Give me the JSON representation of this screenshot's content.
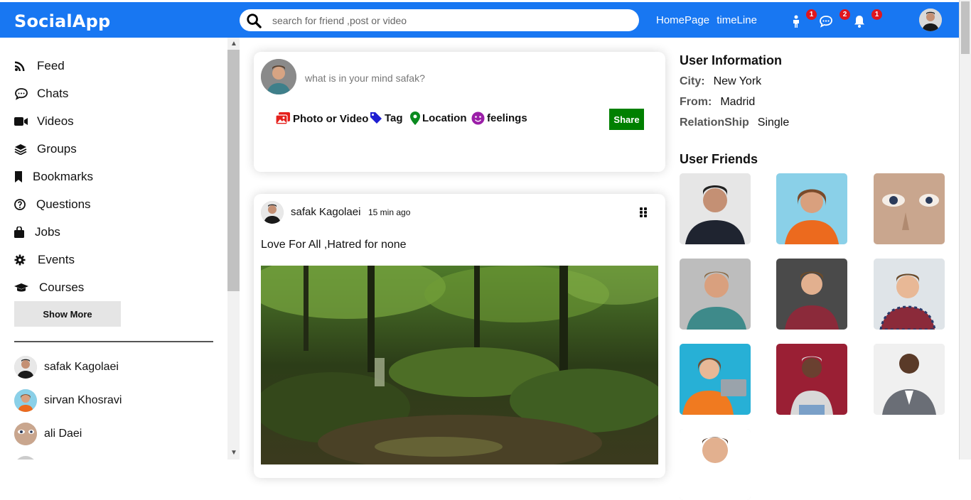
{
  "header": {
    "logo": "SocialApp",
    "search_placeholder": "search for friend ,post or video",
    "links": [
      "HomePage",
      "timeLine"
    ],
    "badges": {
      "person": "1",
      "chat": "2",
      "notifications": "1"
    }
  },
  "sidebar": {
    "items": [
      {
        "label": "Feed",
        "icon": "rss-icon"
      },
      {
        "label": "Chats",
        "icon": "chat-icon"
      },
      {
        "label": "Videos",
        "icon": "video-camera-icon"
      },
      {
        "label": "Groups",
        "icon": "layers-icon"
      },
      {
        "label": "Bookmarks",
        "icon": "bookmark-icon"
      },
      {
        "label": "Questions",
        "icon": "question-circle-icon"
      },
      {
        "label": "Jobs",
        "icon": "briefcase-icon"
      },
      {
        "label": "Events",
        "icon": "gear-icon"
      },
      {
        "label": "Courses",
        "icon": "graduation-cap-icon"
      }
    ],
    "show_more": "Show More",
    "friends": [
      "safak Kagolaei",
      "sirvan Khosravi",
      "ali Daei"
    ]
  },
  "share": {
    "placeholder": "what is in your mind safak?",
    "options": [
      "Photo or Video",
      "Tag",
      "Location",
      "feelings"
    ],
    "button": "Share"
  },
  "post": {
    "author": "safak Kagolaei",
    "time": "15 min ago",
    "text": "Love For All ,Hatred for none"
  },
  "right": {
    "info_title": "User Information",
    "city_label": "City:",
    "city": "New York",
    "from_label": "From:",
    "from": "Madrid",
    "rel_label": "RelationShip",
    "rel": "Single",
    "friends_title": "User Friends"
  },
  "colors": {
    "brand": "#1877f2",
    "badge": "#e0161e",
    "share": "#008000"
  }
}
